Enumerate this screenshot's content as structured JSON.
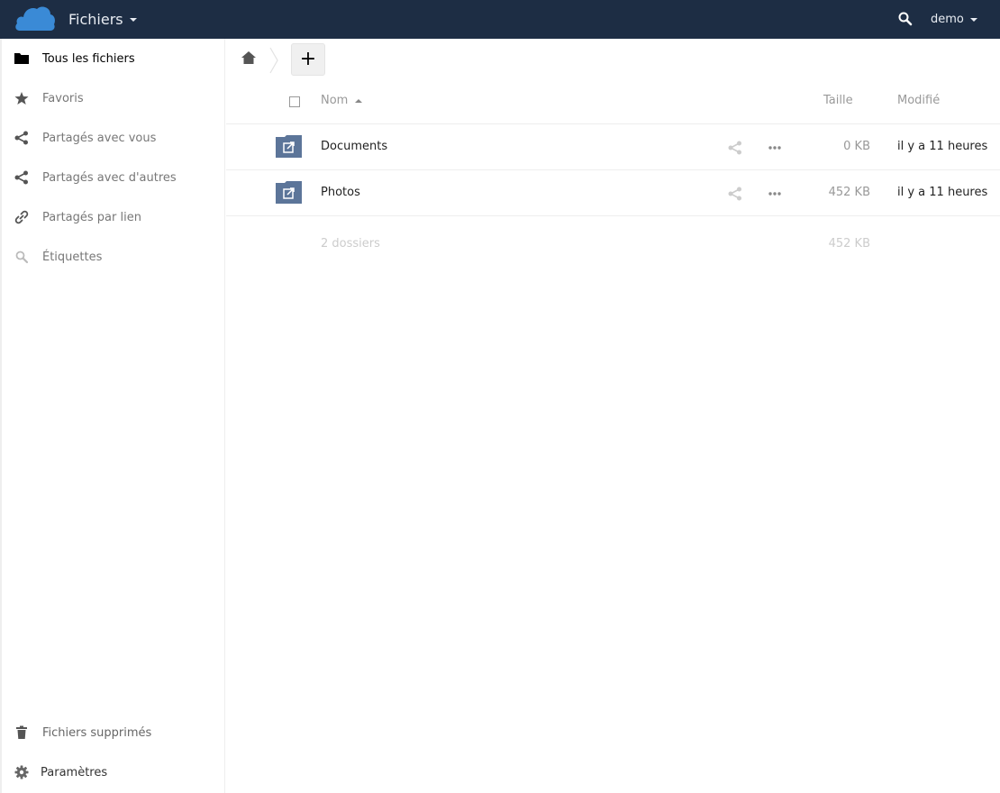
{
  "header": {
    "app_name": "Fichiers",
    "user": "demo",
    "background_color": "#1d2d44",
    "logo_color": "#3a8ad6"
  },
  "sidebar": {
    "items": [
      {
        "label": "Tous les fichiers",
        "icon": "folder-icon",
        "active": true
      },
      {
        "label": "Favoris",
        "icon": "star-icon"
      },
      {
        "label": "Partagés avec vous",
        "icon": "share-icon"
      },
      {
        "label": "Partagés avec d'autres",
        "icon": "share-icon"
      },
      {
        "label": "Partagés par lien",
        "icon": "link-icon"
      },
      {
        "label": "Étiquettes",
        "icon": "tag-search-icon"
      }
    ],
    "bottom": {
      "trash_label": "Fichiers supprimés",
      "settings_label": "Paramètres"
    }
  },
  "controls": {
    "new_label": "+"
  },
  "filelist": {
    "columns": {
      "name": "Nom",
      "size": "Taille",
      "modified": "Modifié"
    },
    "rows": [
      {
        "name": "Documents",
        "size": "0 KB",
        "modified": "il y a 11 heures",
        "icon": "shared-folder-icon"
      },
      {
        "name": "Photos",
        "size": "452 KB",
        "modified": "il y a 11 heures",
        "icon": "shared-folder-icon"
      }
    ],
    "summary": {
      "count": "2 dossiers",
      "total_size": "452 KB"
    },
    "folder_color": "#5c7599"
  }
}
